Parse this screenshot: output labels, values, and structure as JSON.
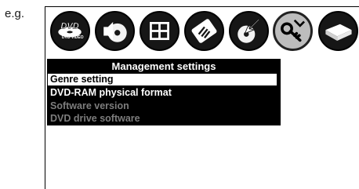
{
  "caption": "e.g.",
  "toolbar": {
    "icons": [
      {
        "name": "dvd-video-icon",
        "label": "DVD VIDEO"
      },
      {
        "name": "disc-speaker-icon"
      },
      {
        "name": "grid-panel-icon"
      },
      {
        "name": "tools-icon"
      },
      {
        "name": "disc-arrow-icon"
      },
      {
        "name": "key-wrench-icon",
        "selected": true
      },
      {
        "name": "drive-icon"
      }
    ]
  },
  "menu": {
    "title": "Management settings",
    "items": [
      {
        "label": "Genre setting",
        "state": "highlighted"
      },
      {
        "label": "DVD-RAM physical format",
        "state": "enabled"
      },
      {
        "label": "Software version",
        "state": "disabled"
      },
      {
        "label": "DVD drive software",
        "state": "disabled"
      }
    ]
  },
  "colors": {
    "background": "#ffffff",
    "menu_bg": "#000000",
    "menu_text": "#ffffff",
    "disabled_text": "#7d7d7d"
  }
}
